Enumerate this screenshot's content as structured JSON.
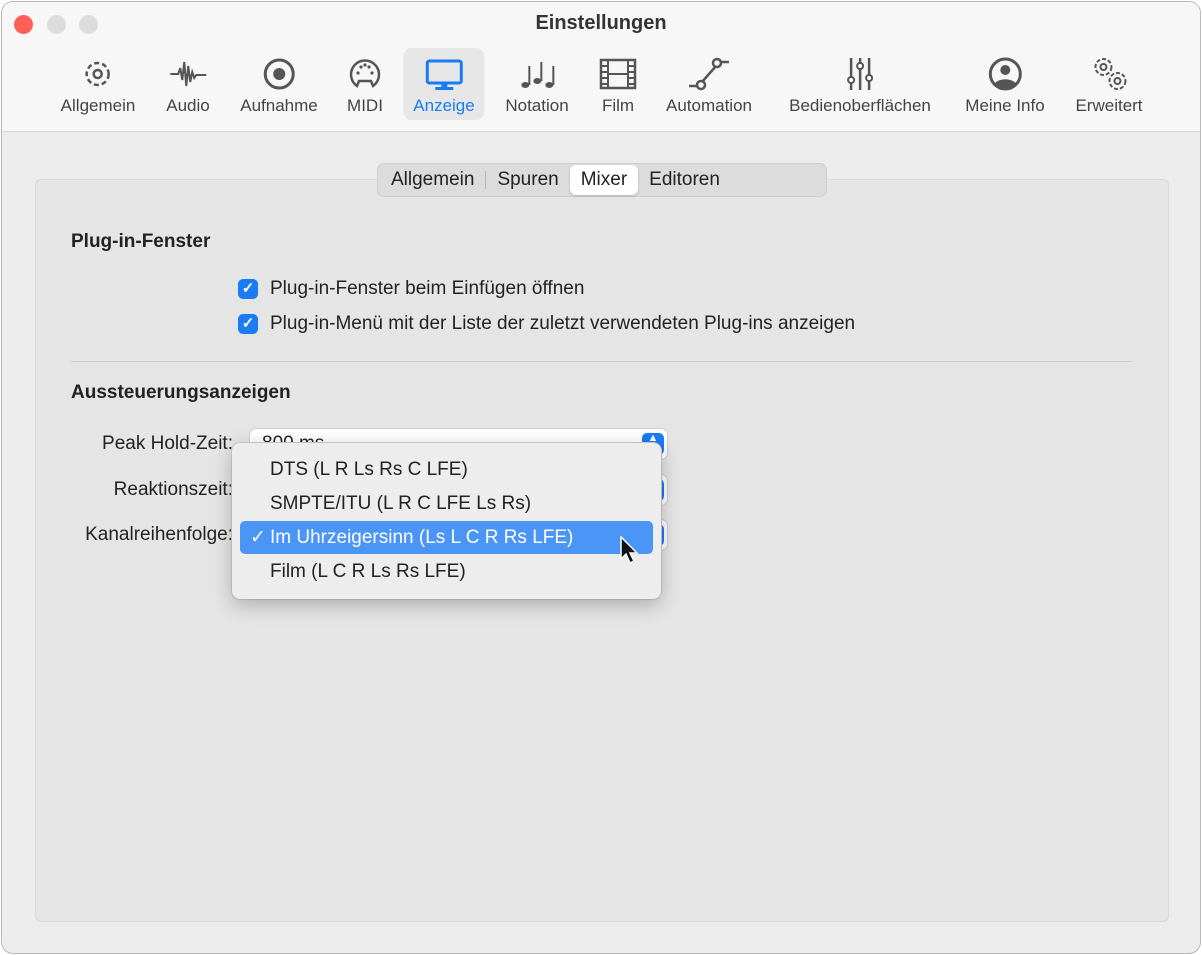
{
  "window": {
    "title": "Einstellungen"
  },
  "toolbar": {
    "items": [
      {
        "label": "Allgemein",
        "icon": "gear-icon"
      },
      {
        "label": "Audio",
        "icon": "waveform-icon"
      },
      {
        "label": "Aufnahme",
        "icon": "record-icon"
      },
      {
        "label": "MIDI",
        "icon": "midi-connector-icon"
      },
      {
        "label": "Anzeige",
        "icon": "display-icon",
        "selected": true
      },
      {
        "label": "Notation",
        "icon": "notes-icon"
      },
      {
        "label": "Film",
        "icon": "film-icon"
      },
      {
        "label": "Automation",
        "icon": "automation-icon"
      },
      {
        "label": "Bedienoberflächen",
        "icon": "sliders-icon"
      },
      {
        "label": "Meine Info",
        "icon": "person-icon"
      },
      {
        "label": "Erweitert",
        "icon": "gears-icon"
      }
    ]
  },
  "tabs": [
    {
      "label": "Allgemein"
    },
    {
      "label": "Spuren"
    },
    {
      "label": "Mixer",
      "selected": true
    },
    {
      "label": "Editoren"
    }
  ],
  "plugin": {
    "heading": "Plug-in-Fenster",
    "options": [
      {
        "label": "Plug-in-Fenster beim Einfügen öffnen",
        "checked": true
      },
      {
        "label": "Plug-in-Menü mit der Liste der zuletzt verwendeten Plug-ins anzeigen",
        "checked": true
      }
    ]
  },
  "meters": {
    "heading": "Aussteuerungsanzeigen",
    "peak_hold": {
      "label": "Peak Hold-Zeit:",
      "value": "800 ms"
    },
    "reaction": {
      "label": "Reaktionszeit:"
    },
    "channel_order": {
      "label": "Kanalreihenfolge:"
    }
  },
  "menu": {
    "items": [
      {
        "label": "DTS (L R Ls Rs C LFE)"
      },
      {
        "label": "SMPTE/ITU (L R C LFE Ls Rs)"
      },
      {
        "label": "Im Uhrzeigersinn (Ls L C R Rs LFE)",
        "checked": true
      },
      {
        "label": "Film (L C R Ls Rs LFE)"
      }
    ],
    "check": "✓"
  },
  "colors": {
    "accent": "#1a7cf5",
    "highlight": "#4a95f6"
  }
}
